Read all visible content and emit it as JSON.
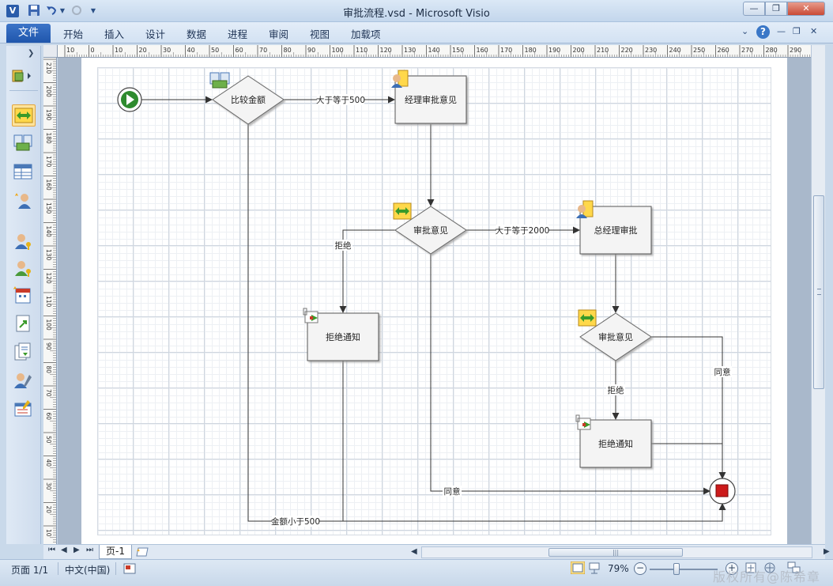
{
  "window": {
    "title": "审批流程.vsd  -  Microsoft Visio",
    "app_icon_letter": "V",
    "quick_access": [
      "save-icon",
      "undo-icon",
      "redo-icon",
      "customize-icon"
    ]
  },
  "ribbon": {
    "file_tab": "文件",
    "tabs": [
      "开始",
      "插入",
      "设计",
      "数据",
      "进程",
      "审阅",
      "视图",
      "加载项"
    ]
  },
  "ruler": {
    "horizontal_labels": [
      "10",
      "0",
      "10",
      "20",
      "30",
      "40",
      "50",
      "60",
      "70",
      "80",
      "90",
      "100",
      "110",
      "120",
      "130",
      "140",
      "150",
      "160",
      "170",
      "180",
      "190",
      "200",
      "210",
      "220",
      "230",
      "240",
      "250",
      "260",
      "270",
      "280",
      "290",
      "300"
    ],
    "vertical_labels": [
      "210",
      "200",
      "190",
      "180",
      "170",
      "160",
      "150",
      "140",
      "130",
      "120",
      "110",
      "100",
      "90",
      "80",
      "70",
      "60",
      "50",
      "40",
      "30",
      "20",
      "10"
    ]
  },
  "diagram": {
    "decision_compare": "比较金额",
    "manager_approval": "经理审批意见",
    "decision_approval_1": "审批意见",
    "gm_approval": "总经理审批",
    "reject_notice_1": "拒绝通知",
    "decision_approval_2": "审批意见",
    "reject_notice_2": "拒绝通知",
    "label_gte_500": "大于等于500",
    "label_gte_2000": "大于等于2000",
    "label_reject_1": "拒绝",
    "label_reject_2": "拒绝",
    "label_agree_1": "同意",
    "label_agree_2": "同意",
    "label_lt_500": "金额小于500"
  },
  "pages": {
    "tabs": [
      "页-1"
    ]
  },
  "status": {
    "page": "页面 1/1",
    "language": "中文(中国)",
    "zoom": "79%",
    "watermark": "版权所有@陈希章"
  },
  "colors": {
    "accent": "#1f56ac",
    "start_green": "#2e8b2e",
    "end_red": "#cc1a1a",
    "selected_tool": "#fde39b"
  }
}
